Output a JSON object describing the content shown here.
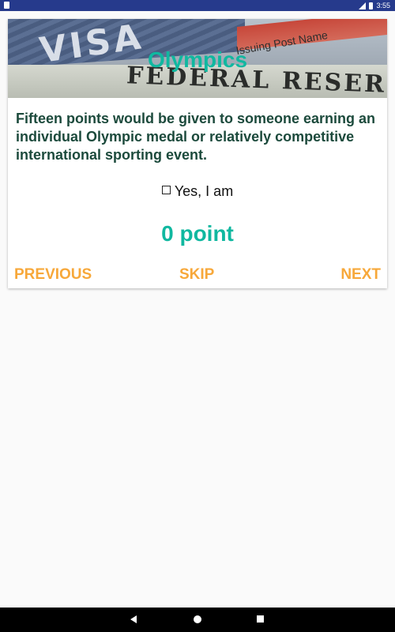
{
  "status_bar": {
    "time": "3:55",
    "icons": [
      "notification-icon",
      "signal-icon",
      "battery-icon"
    ]
  },
  "card": {
    "header_image_text": {
      "visa": "VISA",
      "issuing": "Issuing Post Name",
      "bill": "FEDERAL RESER"
    },
    "title": "Olympics",
    "question": "Fifteen points would be given to someone earning an individual Olympic medal or relatively competitive international sporting event.",
    "checkbox": {
      "label": "Yes, I am",
      "checked": false
    },
    "score": "0 point",
    "buttons": {
      "previous": "PREVIOUS",
      "skip": "SKIP",
      "next": "NEXT"
    }
  },
  "nav_bar": {
    "icons": [
      "back-icon",
      "home-icon",
      "recent-apps-icon"
    ]
  },
  "colors": {
    "status_bar": "#263a8c",
    "title": "#10b8a0",
    "question_text": "#1c4a3c",
    "button_text": "#f7a83a",
    "background": "#fafafa"
  }
}
